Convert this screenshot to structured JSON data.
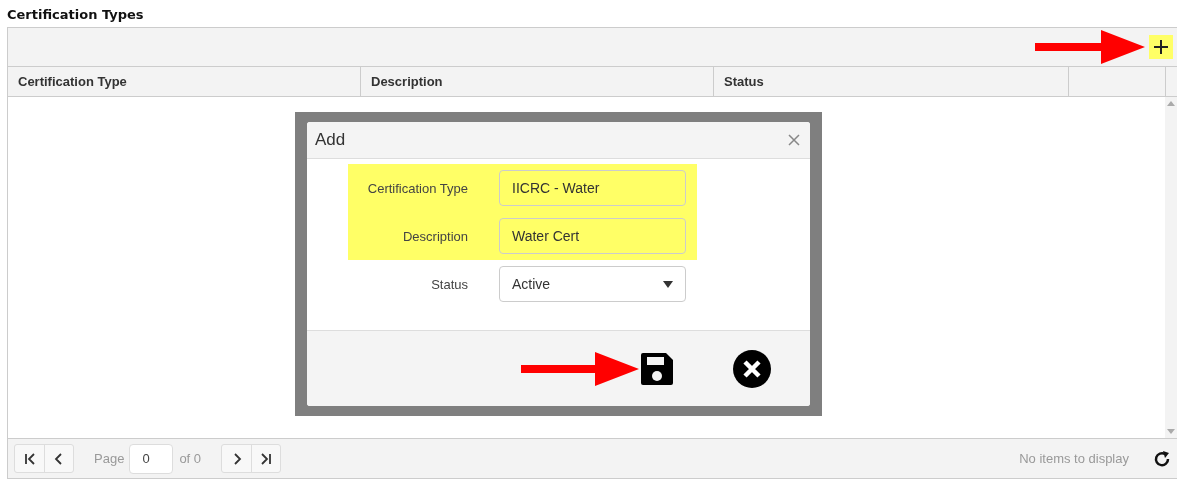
{
  "title": "Certification Types",
  "toolbar": {
    "add_highlighted": true
  },
  "table": {
    "columns": [
      "Certification Type",
      "Description",
      "Status",
      ""
    ]
  },
  "dialog": {
    "title": "Add",
    "fields": [
      {
        "kind": "text",
        "label": "Certification Type",
        "value": "IICRC - Water",
        "highlighted": true
      },
      {
        "kind": "text",
        "label": "Description",
        "value": "Water Cert",
        "highlighted": true
      },
      {
        "kind": "select",
        "label": "Status",
        "value": "Active",
        "highlighted": false
      }
    ]
  },
  "pager": {
    "page_label": "Page",
    "page": "0",
    "of": "of 0",
    "status": "No items to display"
  }
}
